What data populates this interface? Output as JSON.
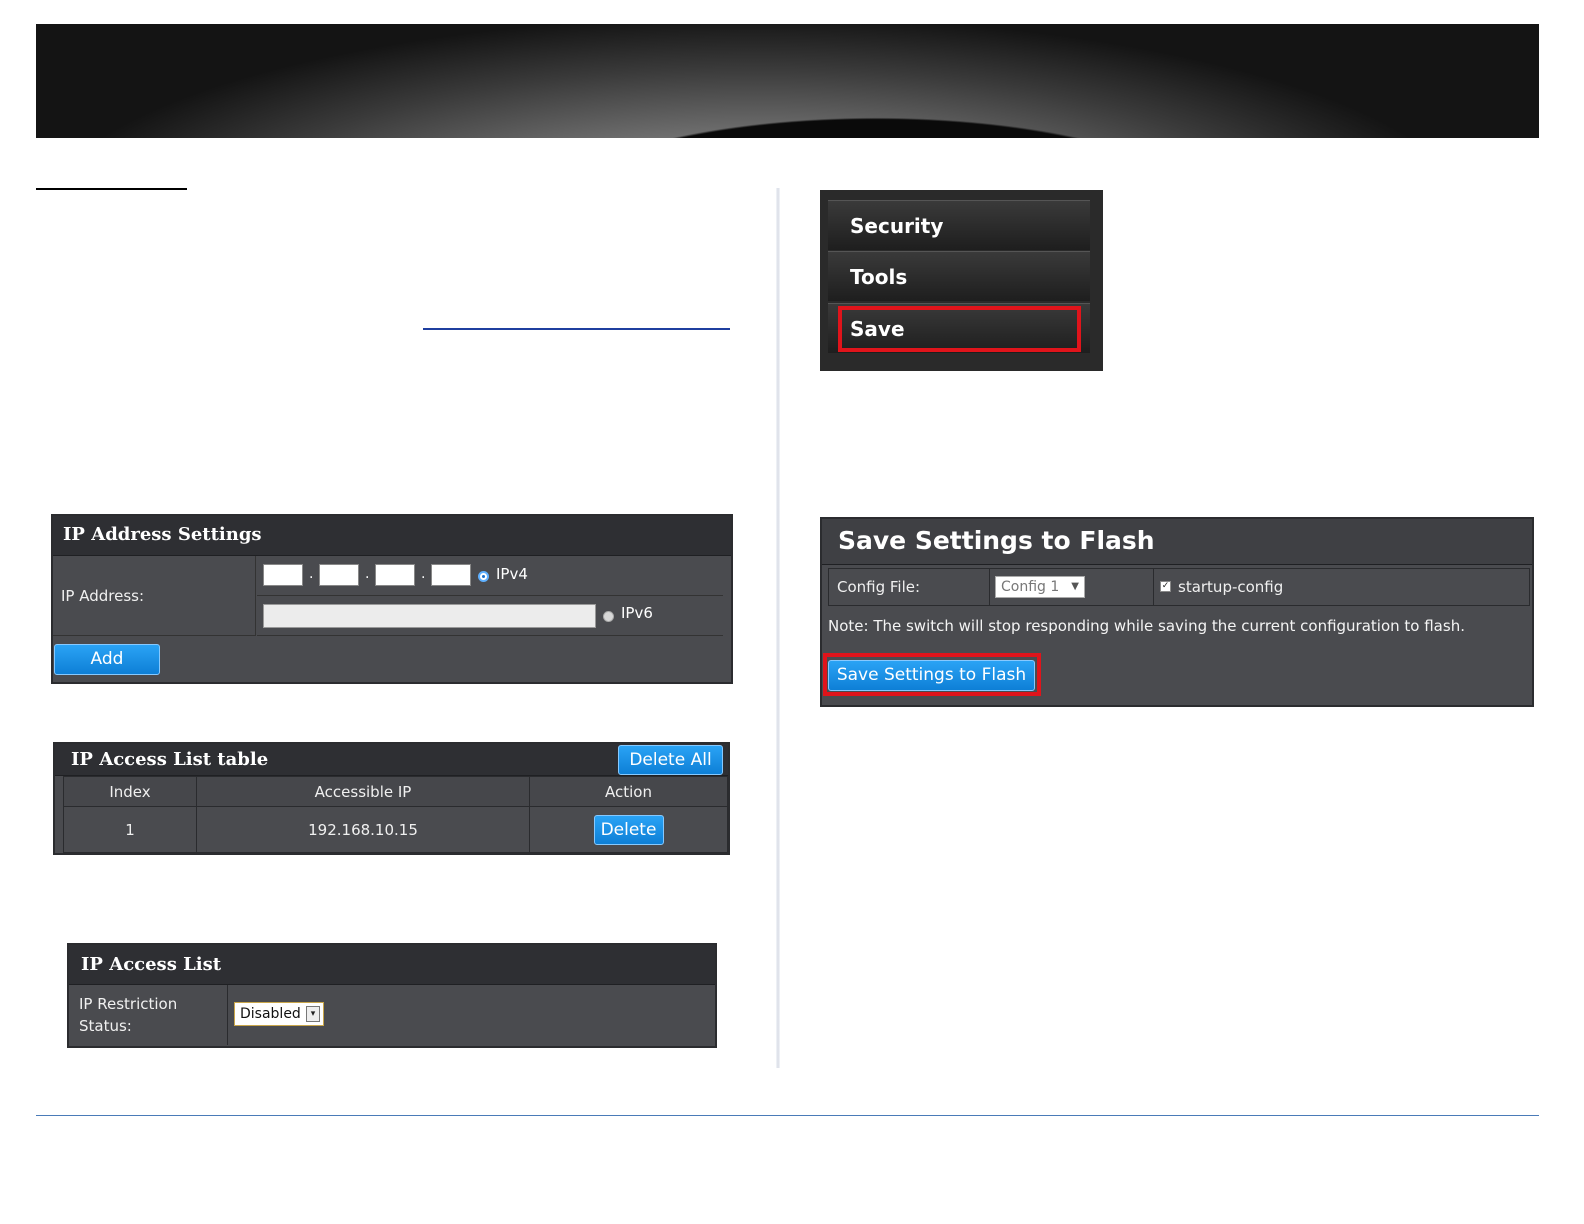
{
  "ip_settings": {
    "title": "IP Address Settings",
    "ip_label": "IP Address:",
    "ipv4_label": "IPv4",
    "ipv6_label": "IPv6",
    "ipv4_selected": true,
    "add_button": "Add"
  },
  "acl_table": {
    "title": "IP Access List table",
    "delete_all_button": "Delete All",
    "columns": [
      "Index",
      "Accessible IP",
      "Action"
    ],
    "rows": [
      {
        "index": "1",
        "ip": "192.168.10.15",
        "action": "Delete"
      }
    ]
  },
  "acl_status": {
    "title": "IP Access List",
    "label_line1": "IP Restriction",
    "label_line2": "Status:",
    "value": "Disabled"
  },
  "side_menu": {
    "items": [
      "Security",
      "Tools",
      "Save"
    ],
    "highlighted": "Save"
  },
  "save_panel": {
    "title": "Save Settings to Flash",
    "config_label": "Config File:",
    "config_value": "Config 1",
    "checkbox_label": "startup-config",
    "checkbox_checked": true,
    "note": "Note: The switch will stop responding while saving the current configuration to flash.",
    "button": "Save Settings to Flash"
  },
  "colors": {
    "highlight": "#e0141b",
    "button_blue": "#1591e8",
    "panel_bg": "#4a4b4f"
  }
}
